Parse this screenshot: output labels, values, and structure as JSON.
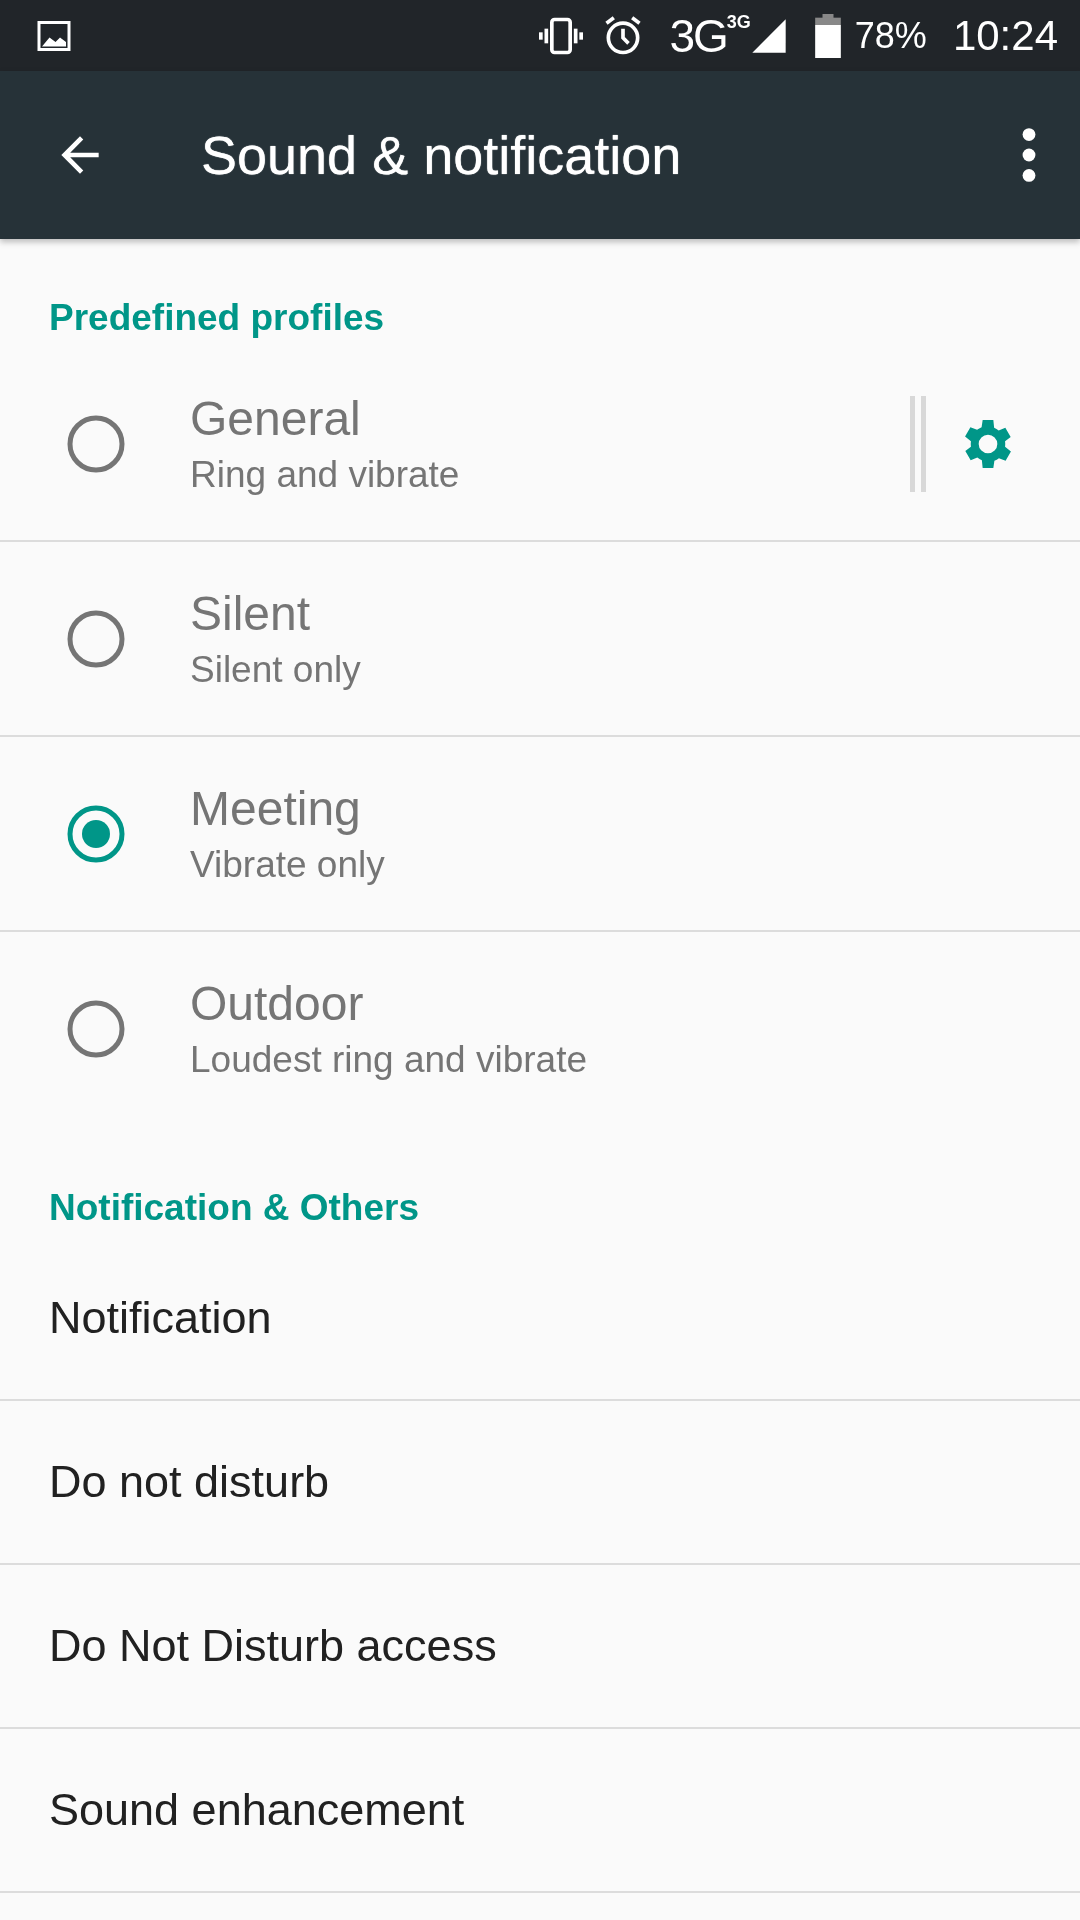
{
  "status_bar": {
    "network": "3G",
    "network_badge": "3G",
    "battery": "78%",
    "time": "10:24"
  },
  "toolbar": {
    "title": "Sound & notification"
  },
  "sections": [
    {
      "title": "Predefined profiles",
      "kind": "profiles",
      "items": [
        {
          "title": "General",
          "summary": "Ring and vibrate",
          "selected": false,
          "settings": true
        },
        {
          "title": "Silent",
          "summary": "Silent only",
          "selected": false,
          "settings": false
        },
        {
          "title": "Meeting",
          "summary": "Vibrate only",
          "selected": true,
          "settings": false
        },
        {
          "title": "Outdoor",
          "summary": "Loudest ring and vibrate",
          "selected": false,
          "settings": false
        }
      ]
    },
    {
      "title": "Notification & Others",
      "kind": "plain",
      "items": [
        {
          "title": "Notification"
        },
        {
          "title": "Do not disturb"
        },
        {
          "title": "Do Not Disturb access"
        },
        {
          "title": "Sound enhancement"
        }
      ]
    }
  ]
}
